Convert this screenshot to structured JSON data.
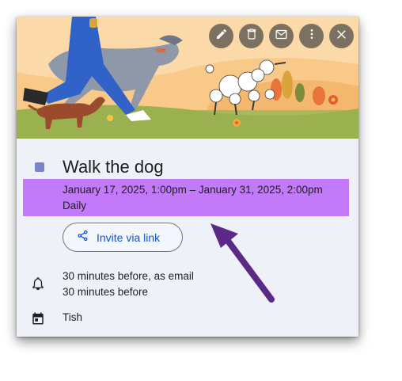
{
  "event": {
    "title": "Walk the dog",
    "datetime": "January 17, 2025, 1:00pm – January 31, 2025, 2:00pm",
    "recurrence": "Daily",
    "color": "#7986cb"
  },
  "invite": {
    "label": "Invite via link"
  },
  "notifications": [
    "30 minutes before, as email",
    "30 minutes before"
  ],
  "calendar": {
    "name": "Tish"
  },
  "toolbar": {
    "icons": [
      "edit-icon",
      "delete-icon",
      "email-icon",
      "more-icon",
      "close-icon"
    ]
  },
  "colors": {
    "highlight": "#c27af8",
    "arrow": "#5b2a86",
    "link": "#0b57d0"
  }
}
